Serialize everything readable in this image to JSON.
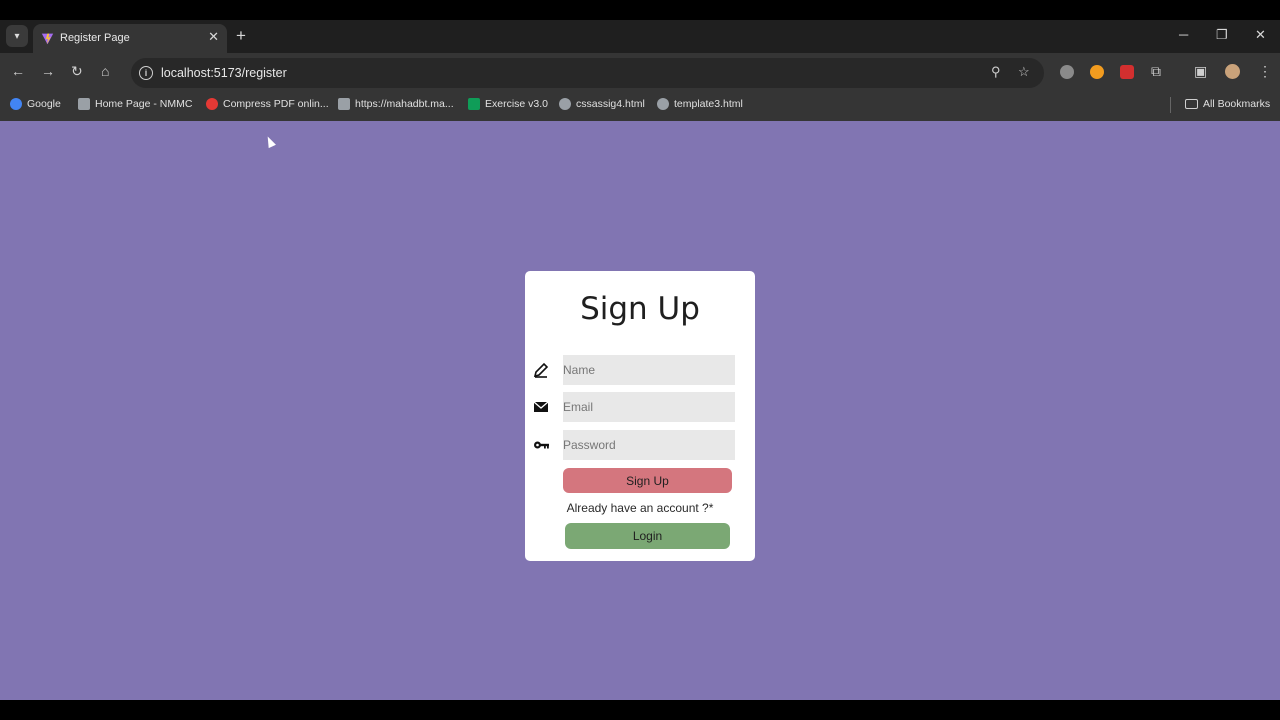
{
  "browser": {
    "tab": {
      "title": "Register Page"
    },
    "url": "localhost:5173/register",
    "bookmarks": [
      {
        "label": "Google",
        "color": "#4285f4"
      },
      {
        "label": "Home Page - NMMC",
        "color": "#9aa0a6"
      },
      {
        "label": "Compress PDF onlin...",
        "color": "#e53935"
      },
      {
        "label": "https://mahadbt.ma...",
        "color": "#9aa0a6"
      },
      {
        "label": "Exercise v3.0",
        "color": "#0f9d58"
      },
      {
        "label": "cssassig4.html",
        "color": "#9aa0a6"
      },
      {
        "label": "template3.html",
        "color": "#9aa0a6"
      }
    ],
    "all_bookmarks": "All Bookmarks"
  },
  "page": {
    "background": "#8175b2",
    "title": "Sign Up",
    "fields": {
      "name_placeholder": "Name",
      "email_placeholder": "Email",
      "password_placeholder": "Password"
    },
    "signup_button": "Sign Up",
    "already_text": "Already have an account ?*",
    "login_button": "Login",
    "colors": {
      "signup": "#d4767e",
      "login": "#7ba874"
    }
  }
}
